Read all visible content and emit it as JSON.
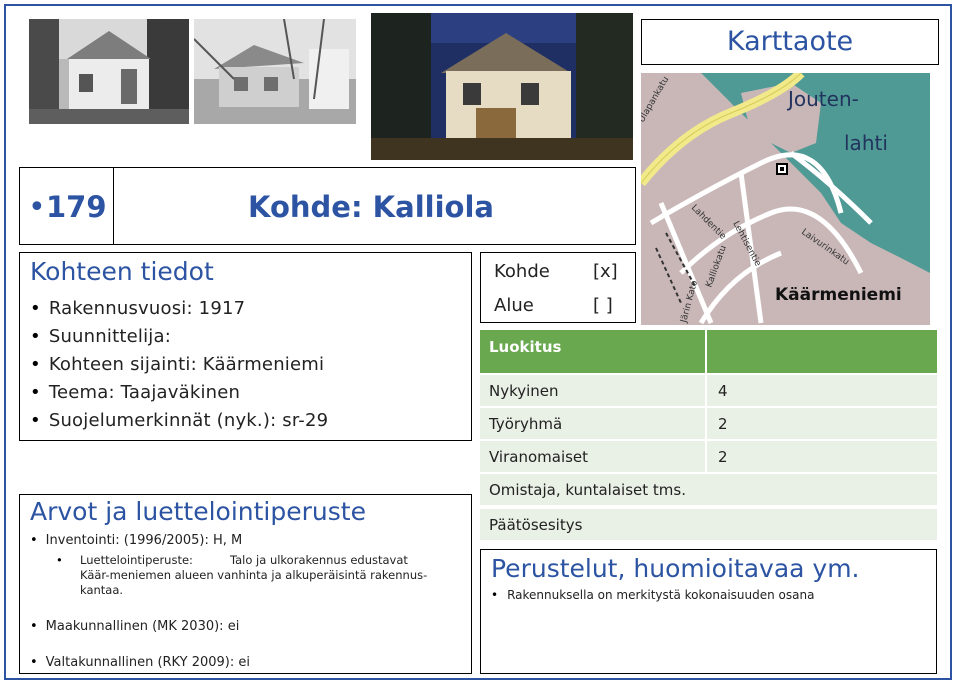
{
  "title": "Karttaote",
  "header": {
    "number": "179",
    "object": "Kohde: Kalliola"
  },
  "kohteen_tiedot": {
    "heading": "Kohteen tiedot",
    "items": [
      "Rakennusvuosi: 1917",
      "Suunnittelija:",
      "Kohteen sijainti: Käärmeniemi",
      "Teema: Taajaväkinen",
      "Suojelumerkinnät (nyk.): sr-29"
    ]
  },
  "kohde_alue": {
    "kohde_label": "Kohde",
    "kohde_value": "[x]",
    "alue_label": "Alue",
    "alue_value": "[ ]"
  },
  "luokitus": {
    "heading": "Luokitus",
    "rows": [
      {
        "label": "Nykyinen",
        "value": "4"
      },
      {
        "label": "Työryhmä",
        "value": "2"
      },
      {
        "label": "Viranomaiset",
        "value": "2"
      },
      {
        "label": "Omistaja, kuntalaiset tms.",
        "value": ""
      },
      {
        "label": "Päätösesitys",
        "value": ""
      }
    ]
  },
  "arvot": {
    "heading": "Arvot ja luettelointiperuste",
    "inventointi": "Inventointi: (1996/2005):   H, M",
    "luettelointiperuste_label": "Luettelointiperuste:",
    "luettelointiperuste_text": "Talo ja ulkorakennus edustavat Käär-meniemen alueen vanhinta ja alkuperäisintä rakennus-kantaa.",
    "maakunnallinen": "Maakunnallinen (MK 2030): ei",
    "valtakunnallinen": "Valtakunnallinen (RKY 2009): ei"
  },
  "perustelut": {
    "heading": "Perustelut, huomioitavaa ym.",
    "items": [
      "Rakennuksella on merkitystä kokonaisuuden osana"
    ]
  },
  "map": {
    "labels": [
      "Jouten-",
      "lahti",
      "Käärmeniemi",
      "Lehtisentie",
      "Laivurinkatu",
      "Ulapankatu",
      "Lahdentie",
      "Kalliokatu",
      "Järin Kato"
    ]
  },
  "colors": {
    "accent": "#2c54a3",
    "table_bg": "#e9f0e5",
    "table_header": "#6aa84f",
    "water": "#4f9a95",
    "land": "#c9b7b8"
  }
}
